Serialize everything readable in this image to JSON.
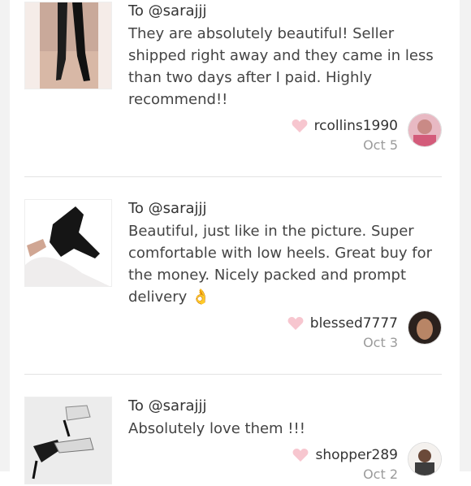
{
  "reviews": [
    {
      "to": "To @sarajjj",
      "text": "They are absolutely beautiful! Seller shipped right away and they came in less than two days after I paid. Highly recommend!!",
      "emoji": "",
      "username": "rcollins1990",
      "date": "Oct 5"
    },
    {
      "to": "To @sarajjj",
      "text": "Beautiful, just like in the picture. Super comfortable with low heels. Great buy for the money. Nicely packed and prompt delivery",
      "emoji": "👌",
      "username": "blessed7777",
      "date": "Oct 3"
    },
    {
      "to": "To @sarajjj",
      "text": "Absolutely love them !!!",
      "emoji": "",
      "username": "shopper289",
      "date": "Oct 2"
    }
  ],
  "colors": {
    "heart": "#f7c6cf",
    "divider": "#e3e3e3",
    "date": "#9b9b9b"
  }
}
